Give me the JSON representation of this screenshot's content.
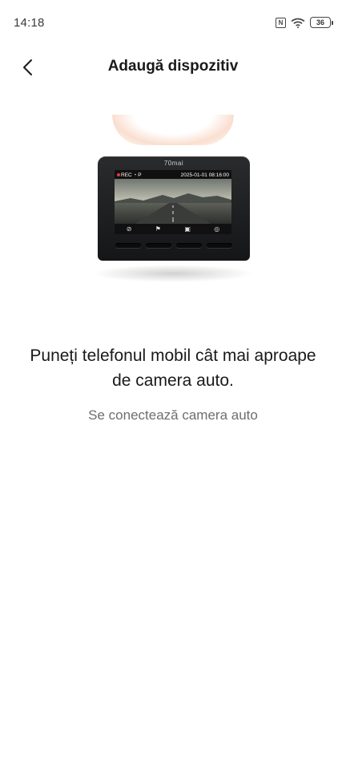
{
  "status_bar": {
    "time": "14:18",
    "battery": "36",
    "icons": [
      "nfc-icon",
      "wifi-icon",
      "battery-icon"
    ]
  },
  "header": {
    "title": "Adaugă dispozitiv",
    "back_icon": "chevron-left-icon"
  },
  "device": {
    "brand": "70mai",
    "osd_rec": "REC",
    "osd_mode": "P",
    "osd_datetime": "2025-01-01 08:16:00"
  },
  "main": {
    "headline": "Puneți telefonul mobil cât mai aproape de camera auto.",
    "status": "Se conectează camera auto"
  },
  "colors": {
    "background": "#ffffff",
    "text_primary": "#1a1a1a",
    "text_secondary": "#6e6e6e",
    "glow_accent": "#f6c4aa",
    "rec_red": "#e53935"
  }
}
